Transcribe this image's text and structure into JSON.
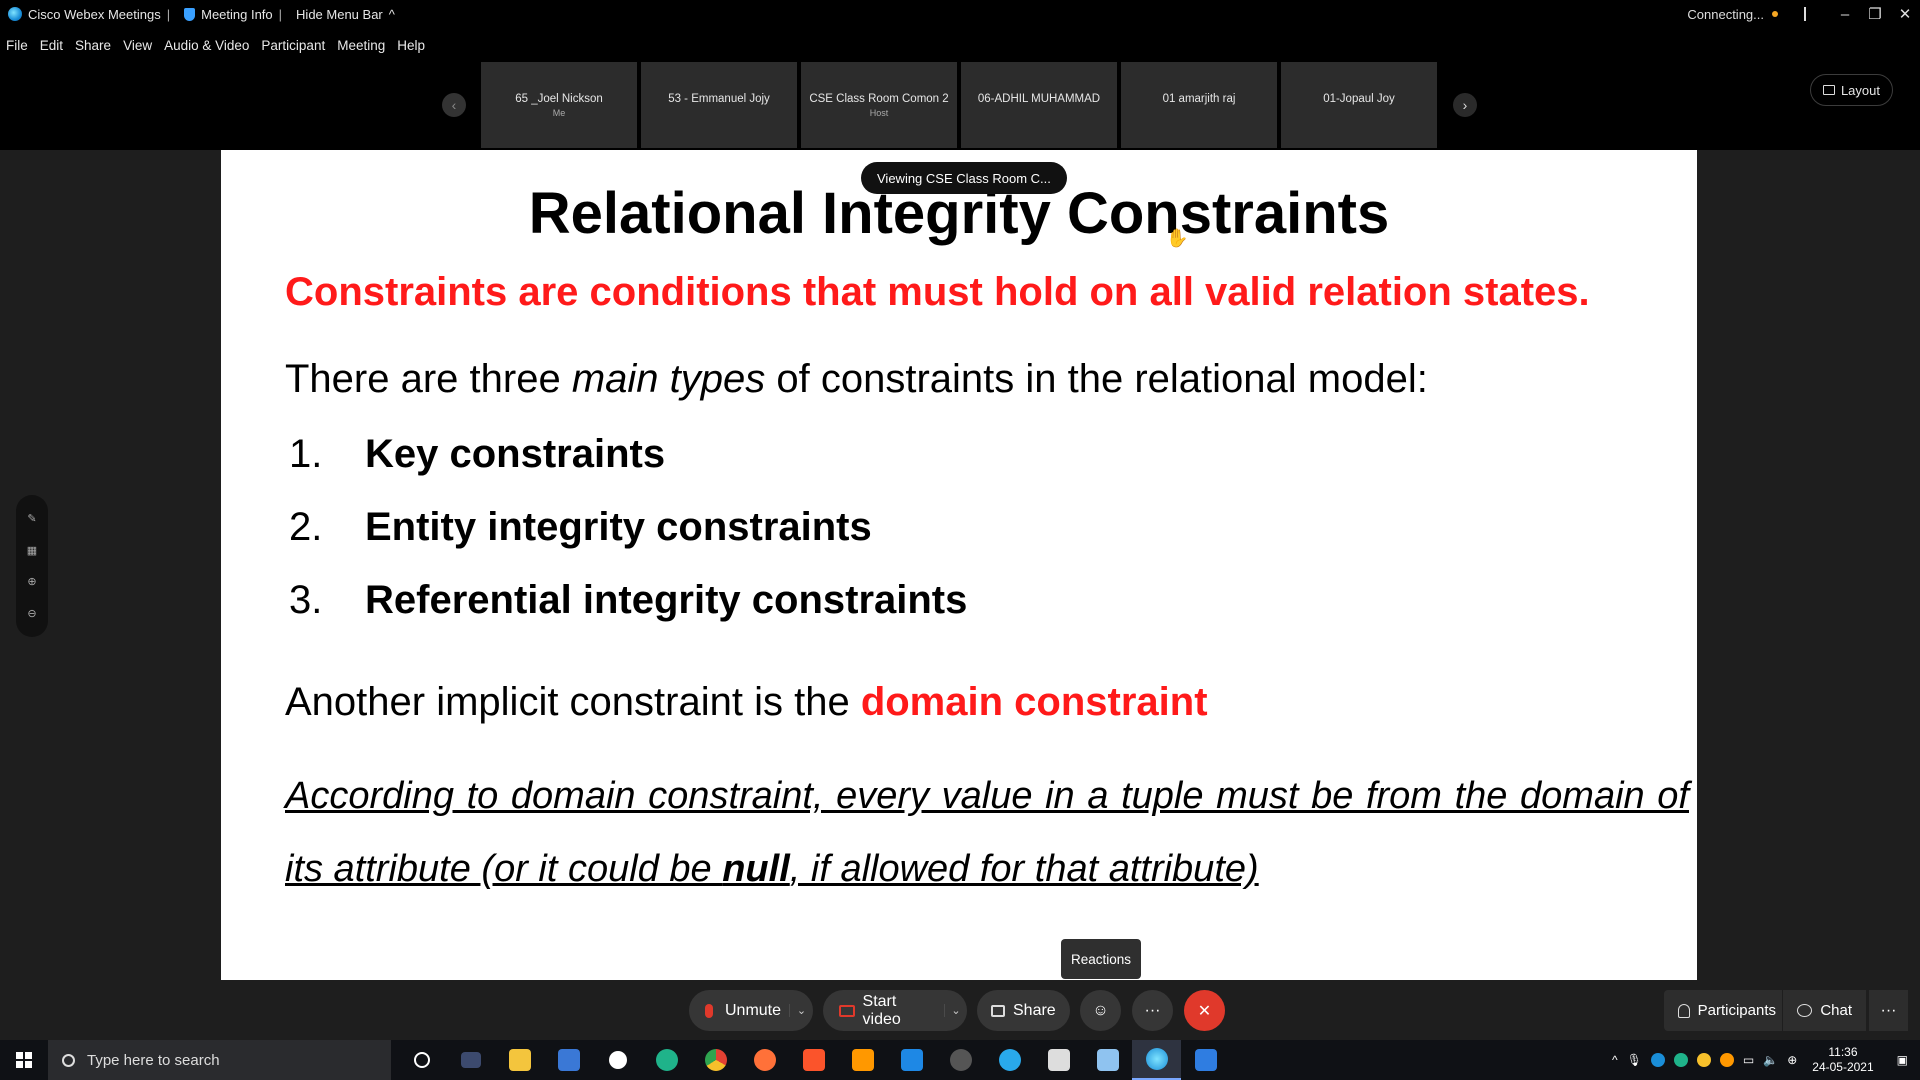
{
  "titlebar": {
    "app_name": "Cisco Webex Meetings",
    "meeting_info": "Meeting Info",
    "hide_menu": "Hide Menu Bar",
    "connecting": "Connecting...",
    "colors": {
      "connecting_dot": "#f5a623"
    }
  },
  "menu": [
    "File",
    "Edit",
    "Share",
    "View",
    "Audio & Video",
    "Participant",
    "Meeting",
    "Help"
  ],
  "participants_strip": [
    {
      "name": "65 _Joel Nickson",
      "role": "Me"
    },
    {
      "name": "53 - Emmanuel Jojy",
      "role": ""
    },
    {
      "name": "CSE Class Room Comon 2",
      "role": "Host"
    },
    {
      "name": "06-ADHIL MUHAMMAD",
      "role": ""
    },
    {
      "name": "01 amarjith raj",
      "role": ""
    },
    {
      "name": "01-Jopaul Joy",
      "role": ""
    }
  ],
  "layout_label": "Layout",
  "viewing_label": "Viewing CSE Class Room C...",
  "slide": {
    "title": "Relational Integrity Constraints",
    "red_line": "Constraints are conditions that must hold on all valid relation states.",
    "intro_a": "There are three ",
    "intro_em": "main types",
    "intro_b": " of constraints in the relational model:",
    "list": [
      {
        "num": "1.",
        "text": "Key constraints"
      },
      {
        "num": "2.",
        "text": "Entity integrity constraints"
      },
      {
        "num": "3.",
        "text": "Referential integrity constraints"
      }
    ],
    "another_a": "Another implicit constraint is the ",
    "another_red": "domain constraint",
    "according_a": "According to domain constraint, every value in a tuple must be from the domain of its attribute (or it could be ",
    "according_b": "null",
    "according_c": ", if allowed for that attribute)",
    "colors": {
      "red": "#ff1a1a"
    }
  },
  "reactions_label": "Reactions",
  "controls": {
    "unmute": "Unmute",
    "start_video": "Start video",
    "share": "Share",
    "more": "···",
    "participants": "Participants",
    "chat": "Chat",
    "end_color": "#e0392b"
  },
  "taskbar": {
    "search_placeholder": "Type here to search",
    "time": "11:36",
    "date": "24-05-2021"
  }
}
